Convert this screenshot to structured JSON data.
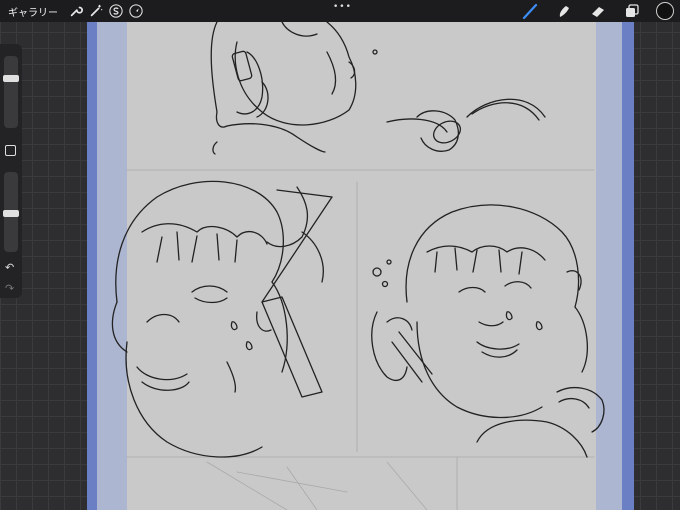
{
  "toolbar": {
    "gallery_label": "ギャラリー",
    "more_dots": "•••",
    "actions_icon": "wrench-icon",
    "adjustments_icon": "magic-wand-icon",
    "selection_icon": "selection-s-icon",
    "transform_icon": "arrow-cursor-icon",
    "brush_icon": "brush-icon",
    "smudge_icon": "smudge-icon",
    "eraser_icon": "eraser-icon",
    "layers_icon": "layers-icon",
    "active_color": "#111111",
    "active_tool_color": "#3e8ef7"
  },
  "sidebar": {
    "brush_size_level": 0.15,
    "opacity_level": 0.25
  },
  "canvas": {
    "bleed_color": "#6b7fc4",
    "paper_color": "#c9c9c9"
  }
}
